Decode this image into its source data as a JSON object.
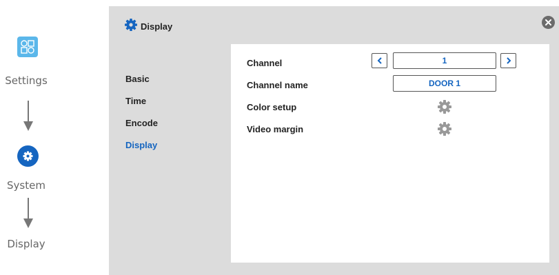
{
  "flow": {
    "step1_label": "Settings",
    "step2_label": "System",
    "step3_label": "Display"
  },
  "dialog": {
    "title": "Display",
    "close_icon": "close-icon"
  },
  "menu": {
    "items": [
      {
        "label": "Basic",
        "active": false
      },
      {
        "label": "Time",
        "active": false
      },
      {
        "label": "Encode",
        "active": false
      },
      {
        "label": "Display",
        "active": true
      }
    ]
  },
  "panel": {
    "channel_label": "Channel",
    "channel_value": "1",
    "channel_name_label": "Channel name",
    "channel_name_value": "DOOR 1",
    "color_setup_label": "Color setup",
    "video_margin_label": "Video margin"
  },
  "colors": {
    "accent": "#1565c0",
    "settings_icon": "#5bb7ea",
    "panel_bg": "#dcdcdc"
  }
}
